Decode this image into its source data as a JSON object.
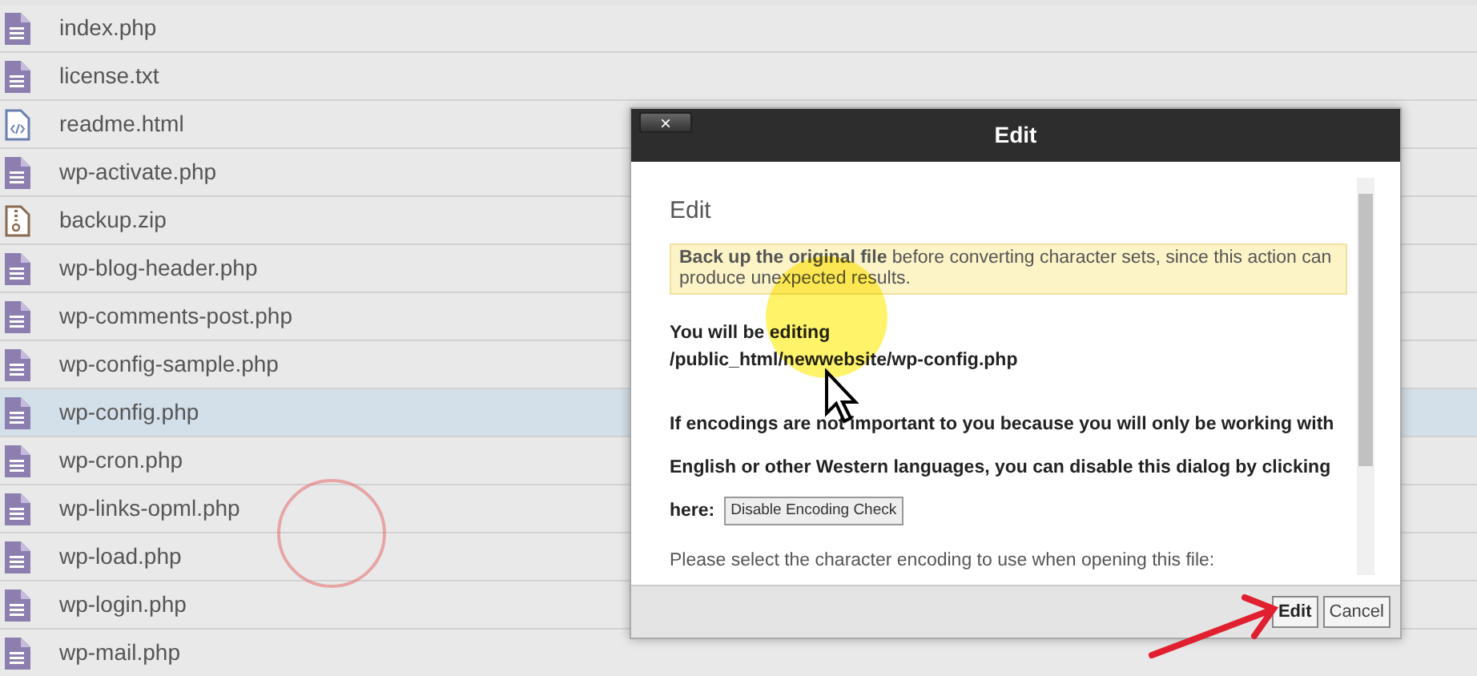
{
  "files": [
    {
      "name": "index.php",
      "kind": "doc",
      "selected": false
    },
    {
      "name": "license.txt",
      "kind": "doc",
      "selected": false
    },
    {
      "name": "readme.html",
      "kind": "code",
      "selected": false
    },
    {
      "name": "wp-activate.php",
      "kind": "doc",
      "selected": false
    },
    {
      "name": "backup.zip",
      "kind": "zip",
      "selected": false
    },
    {
      "name": "wp-blog-header.php",
      "kind": "doc",
      "selected": false
    },
    {
      "name": "wp-comments-post.php",
      "kind": "doc",
      "selected": false
    },
    {
      "name": "wp-config-sample.php",
      "kind": "doc",
      "selected": false
    },
    {
      "name": "wp-config.php",
      "kind": "doc",
      "selected": true
    },
    {
      "name": "wp-cron.php",
      "kind": "doc",
      "selected": false
    },
    {
      "name": "wp-links-opml.php",
      "kind": "doc",
      "selected": false
    },
    {
      "name": "wp-load.php",
      "kind": "doc",
      "selected": false
    },
    {
      "name": "wp-login.php",
      "kind": "doc",
      "selected": false
    },
    {
      "name": "wp-mail.php",
      "kind": "doc",
      "selected": false
    }
  ],
  "dialog": {
    "close": "×",
    "title": "Edit",
    "heading": "Edit",
    "warning": "**Back up the original file** before converting character sets, since this action can produce unexpected results.",
    "editing_label": "You will be editing",
    "editing_path": "/public_html/newwebsite/wp-config.php",
    "info": "If encodings are not important to you because you will only be working with English or other Western languages, you can disable this dialog by clicking",
    "info_end": "here:",
    "disable_button": "Disable Encoding Check",
    "select_prompt": "Please select the character encoding to use when opening this file:",
    "buttons": [
      {
        "label": "Edit",
        "kind": "primary"
      },
      {
        "label": "Cancel",
        "kind": "secondary"
      }
    ]
  }
}
